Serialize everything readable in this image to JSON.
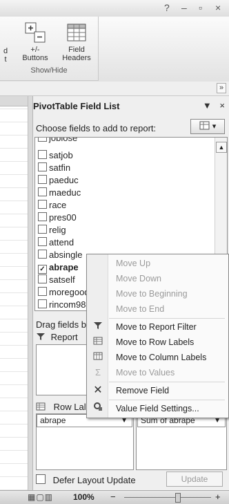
{
  "window": {
    "help_glyph": "?",
    "minimize_glyph": "–",
    "restore_glyph": "▫",
    "close_glyph": "×"
  },
  "ribbon": {
    "partial_left_top": "d",
    "partial_left_bottom": "t",
    "buttons": [
      {
        "label_top": "+/-",
        "label_bottom": "Buttons",
        "icon": "plus-minus-icon"
      },
      {
        "label_top": "Field",
        "label_bottom": "Headers",
        "icon": "field-headers-icon"
      }
    ],
    "group_label": "Show/Hide",
    "expand_glyph": "»"
  },
  "pane": {
    "title": "PivotTable Field List",
    "menu_glyph": "▼",
    "close_glyph": "×",
    "choose_label": "Choose fields to add to report:",
    "layout_button_glyph": "▾",
    "fields": [
      {
        "name": "joblose",
        "checked": false
      },
      {
        "name": "satjob",
        "checked": false
      },
      {
        "name": "satfin",
        "checked": false
      },
      {
        "name": "paeduc",
        "checked": false
      },
      {
        "name": "maeduc",
        "checked": false
      },
      {
        "name": "race",
        "checked": false
      },
      {
        "name": "pres00",
        "checked": false
      },
      {
        "name": "relig",
        "checked": false
      },
      {
        "name": "attend",
        "checked": false
      },
      {
        "name": "absingle",
        "checked": false
      },
      {
        "name": "abrape",
        "checked": true
      },
      {
        "name": "satself",
        "checked": false
      },
      {
        "name": "moregood",
        "checked": false
      },
      {
        "name": "rincom98",
        "checked": false
      }
    ],
    "drag_label": "Drag fields be",
    "report_filter_label": "Report",
    "row_labels_label": "Row Lal",
    "row_item": "abrape",
    "values_item": "Sum of abrape",
    "defer_label": "Defer Layout Update",
    "update_label": "Update"
  },
  "context_menu": {
    "items": [
      {
        "label": "Move Up",
        "enabled": false,
        "icon": ""
      },
      {
        "label": "Move Down",
        "enabled": false,
        "icon": ""
      },
      {
        "label": "Move to Beginning",
        "enabled": false,
        "icon": ""
      },
      {
        "label": "Move to End",
        "enabled": false,
        "icon": ""
      },
      {
        "label": "Move to Report Filter",
        "enabled": true,
        "icon": "filter-icon"
      },
      {
        "label": "Move to Row Labels",
        "enabled": true,
        "icon": "row-labels-icon"
      },
      {
        "label": "Move to Column Labels",
        "enabled": true,
        "icon": "column-labels-icon"
      },
      {
        "label": "Move to Values",
        "enabled": false,
        "icon": "sigma-icon"
      },
      {
        "label": "Remove Field",
        "enabled": true,
        "icon": "remove-x-icon"
      },
      {
        "label": "Value Field Settings...",
        "enabled": true,
        "icon": "field-settings-icon"
      }
    ]
  },
  "statusbar": {
    "zoom": "100%",
    "zoom_minus": "−",
    "zoom_plus": "+"
  }
}
